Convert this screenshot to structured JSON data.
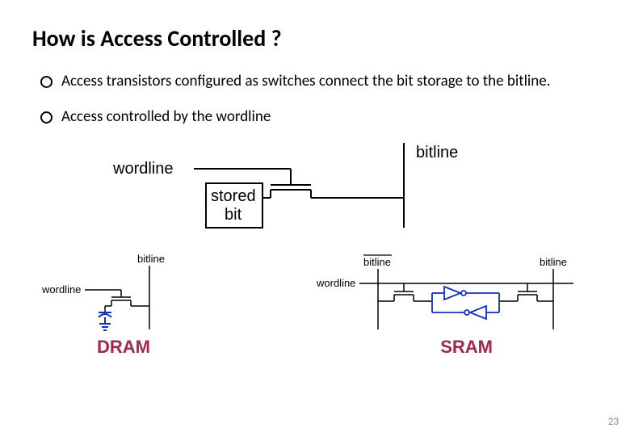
{
  "title": "How is Access Controlled ?",
  "bullets": [
    "Access transistors configured as switches connect the bit storage to the bitline.",
    "Access controlled by the wordline"
  ],
  "main_diagram": {
    "wordline_label": "wordline",
    "bitline_label": "bitline",
    "stored_bit_label_line1": "stored",
    "stored_bit_label_line2": "bit"
  },
  "dram": {
    "caption": "DRAM",
    "wordline_label": "wordline",
    "bitline_label": "bitline"
  },
  "sram": {
    "caption": "SRAM",
    "wordline_label": "wordline",
    "bitline_label": "bitline",
    "bitline_bar_label": "bitline"
  },
  "page_number": "23"
}
